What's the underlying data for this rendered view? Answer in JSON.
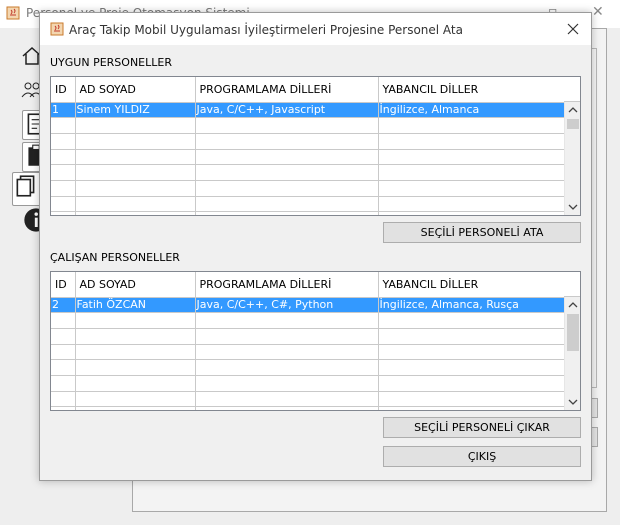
{
  "background_window": {
    "title": "Personel ve Proje Otomasyon Sistemi"
  },
  "dialog": {
    "title": "Araç Takip Mobil Uygulaması İyileştirmeleri Projesine Personel Ata",
    "available": {
      "label": "UYGUN PERSONELLER",
      "columns": [
        "ID",
        "AD SOYAD",
        "PROGRAMLAMA DİLLERİ",
        "YABANCIL DİLLER"
      ],
      "rows": [
        [
          "1",
          "Sinem YILDIZ",
          "Java, C/C++, Javascript",
          "İngilizce, Almanca"
        ]
      ],
      "selected_row": 0,
      "assign_button": "SEÇİLİ PERSONELİ ATA"
    },
    "working": {
      "label": "ÇALIŞAN PERSONELLER",
      "columns": [
        "ID",
        "AD SOYAD",
        "PROGRAMLAMA DİLLERİ",
        "YABANCIL DİLLER"
      ],
      "rows": [
        [
          "2",
          "Fatih ÖZCAN",
          "Java, C/C++, C#, Python",
          "İngilizce, Almanca, Rusça"
        ]
      ],
      "selected_row": 0,
      "remove_button": "SEÇİLİ PERSONELİ ÇIKAR"
    },
    "exit_button": "ÇIKIŞ"
  },
  "colors": {
    "selection": "#3399ff",
    "grid_line": "#c9c9c9"
  }
}
